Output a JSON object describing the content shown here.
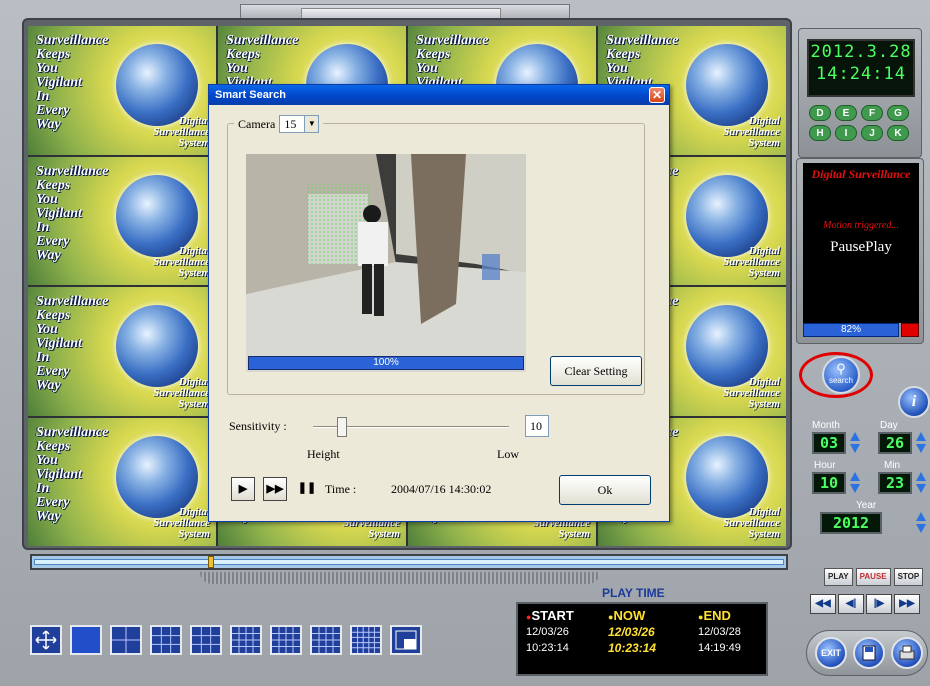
{
  "tile": {
    "line1": "Surveillance\nKeeps\nYou\nVigilant\nIn\nEvery\nWay",
    "line2": "Digital\nSurveillance\nSystem"
  },
  "clock": {
    "date": "2012.3.28",
    "time": "14:24:14"
  },
  "keys": [
    "D",
    "E",
    "F",
    "G",
    "H",
    "I",
    "J",
    "K"
  ],
  "info": {
    "title": "Digital Surveillance",
    "message": "Motion triggered...",
    "status": "PausePlay",
    "progress": "82%"
  },
  "search_button": {
    "label": "search"
  },
  "info_button": {
    "label": "i"
  },
  "datetime": {
    "month_label": "Month",
    "day_label": "Day",
    "hour_label": "Hour",
    "min_label": "Min",
    "year_label": "Year",
    "month": "03",
    "day": "26",
    "hour": "10",
    "min": "23",
    "year": "2012"
  },
  "playback": {
    "play": "PLAY",
    "pause": "PAUSE",
    "stop": "STOP"
  },
  "nav": [
    "◀◀",
    "◀|",
    "|▶",
    "▶▶"
  ],
  "round_buttons": [
    "EXIT",
    "",
    ""
  ],
  "playtime": {
    "title": "PLAY TIME",
    "start_label": "START",
    "now_label": "NOW",
    "end_label": "END",
    "start_date": "12/03/26",
    "start_time": "10:23:14",
    "now_date": "12/03/26",
    "now_time": "10:23:14",
    "end_date": "12/03/28",
    "end_time": "14:19:49"
  },
  "dialog": {
    "title": "Smart Search",
    "camera_label": "Camera",
    "camera_value": "15",
    "video_progress": "100%",
    "clear_label": "Clear Setting",
    "sensitivity_label": "Sensitivity :",
    "sensitivity_value": "10",
    "high_label": "Height",
    "low_label": "Low",
    "time_label": "Time :",
    "time_value": "2004/07/16 14:30:02",
    "ok_label": "Ok",
    "close": "✕"
  }
}
